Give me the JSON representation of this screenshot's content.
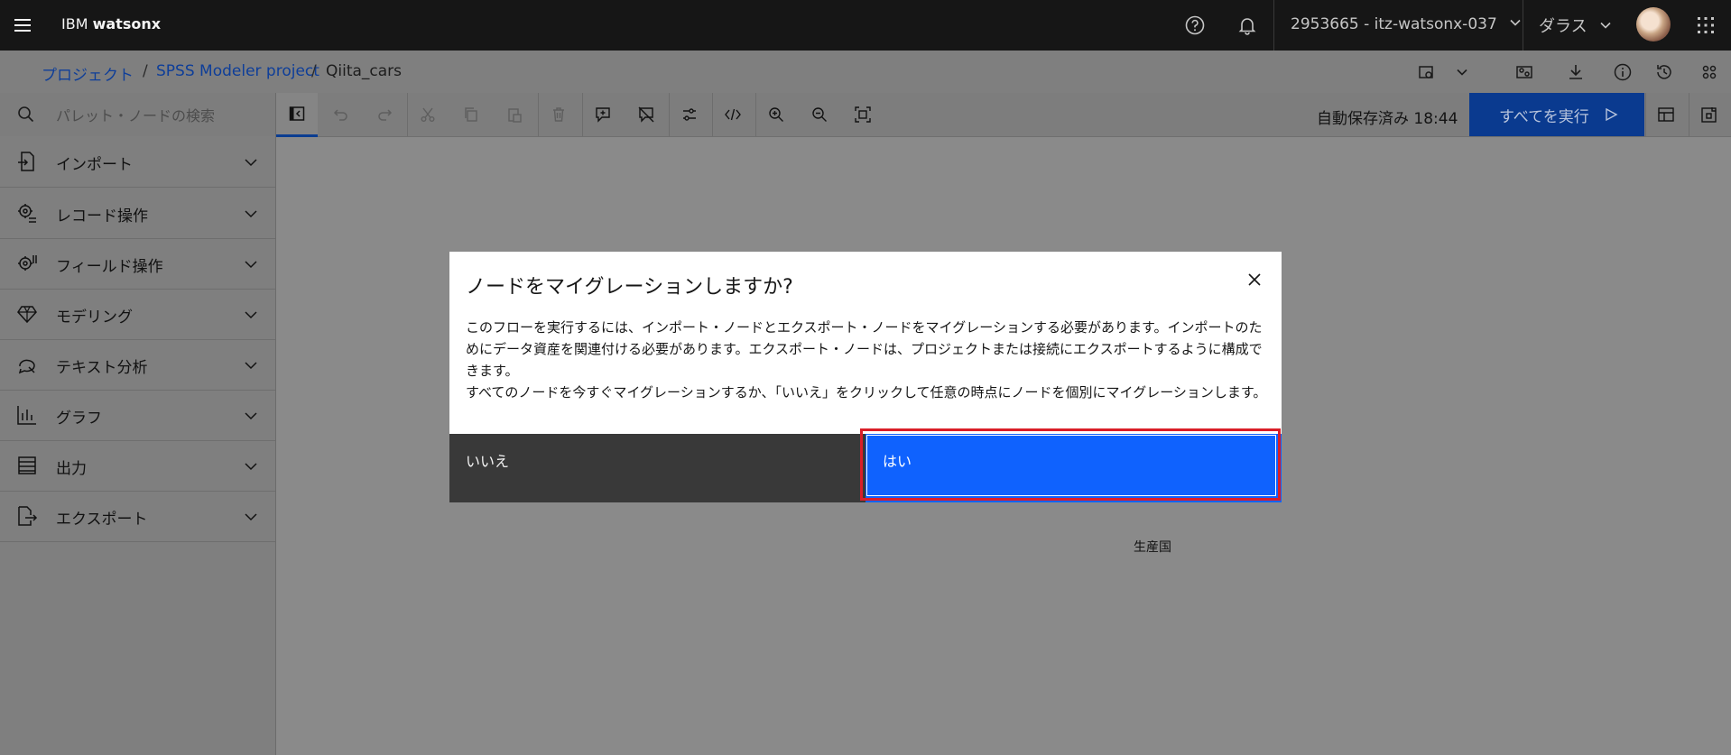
{
  "header": {
    "brand_prefix": "IBM",
    "brand_name": "watsonx",
    "account": "2953665 - itz-watsonx-037",
    "region": "ダラス"
  },
  "breadcrumb": {
    "items": [
      "プロジェクト",
      "SPSS Modeler project"
    ],
    "current": "Qiita_cars",
    "separator": "/"
  },
  "toolbar": {
    "search_placeholder": "パレット・ノードの検索",
    "autosave": "自動保存済み 18:44",
    "run_all": "すべてを実行"
  },
  "sidebar": {
    "items": [
      {
        "label": "インポート",
        "icon": "import-icon"
      },
      {
        "label": "レコード操作",
        "icon": "record-ops-icon"
      },
      {
        "label": "フィールド操作",
        "icon": "field-ops-icon"
      },
      {
        "label": "モデリング",
        "icon": "diamond-icon"
      },
      {
        "label": "テキスト分析",
        "icon": "text-analysis-icon"
      },
      {
        "label": "グラフ",
        "icon": "chart-icon"
      },
      {
        "label": "出力",
        "icon": "output-icon"
      },
      {
        "label": "エクスポート",
        "icon": "export-icon"
      }
    ]
  },
  "canvas": {
    "node_label": "生産国"
  },
  "modal": {
    "title": "ノードをマイグレーションしますか?",
    "body_line1": "このフローを実行するには、インポート・ノードとエクスポート・ノードをマイグレーションする必要があります。インポートのためにデータ資産を関連付ける必要があります。エクスポート・ノードは、プロジェクトまたは接続にエクスポートするように構成できます。",
    "body_line2": "すべてのノードを今すぐマイグレーションするか、「いいえ」をクリックして任意の時点にノードを個別にマイグレーションします。",
    "secondary_button": "いいえ",
    "primary_button": "はい"
  },
  "colors": {
    "primary": "#0f62fe",
    "secondary": "#393939",
    "highlight": "#da1e28",
    "header_bg": "#161616"
  }
}
